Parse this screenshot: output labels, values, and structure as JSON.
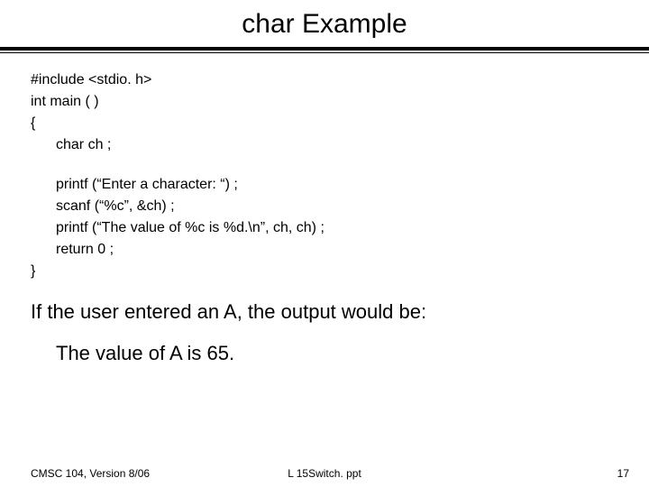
{
  "title": "char Example",
  "code": {
    "l0": "#include <stdio. h>",
    "l1": "int main ( )",
    "l2": "{",
    "l3": "char ch ;",
    "l4": "printf (“Enter a character: “) ;",
    "l5": "scanf (“%c”, &ch) ;",
    "l6": "printf (“The value of %c is %d.\\n”, ch, ch) ;",
    "l7": "return 0 ;",
    "l8": "}"
  },
  "explanation": "If the user entered an A, the output would be:",
  "output": "The value of A is 65.",
  "footer": {
    "left": "CMSC 104, Version 8/06",
    "center": "L 15Switch. ppt",
    "right": "17"
  }
}
